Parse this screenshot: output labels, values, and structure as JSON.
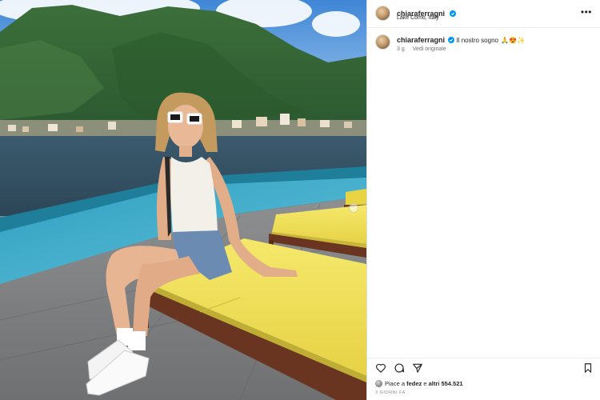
{
  "post": {
    "username": "chiaraferragni",
    "location": "Lake Como, Italy",
    "more_label": "•••",
    "caption": {
      "username": "chiaraferragni",
      "text": "Il nostro sogno",
      "emojis": "🙏😍✨",
      "age": "3 g",
      "translate_label": "Vedi originale"
    },
    "likes": {
      "prefix": "Piace a ",
      "first_user": "fedez",
      "connector": " e ",
      "others": "altri 554.521"
    },
    "date": "3 GIORNI FA"
  },
  "icons": {
    "verified": "verified-badge-icon",
    "like": "heart-icon",
    "comment": "comment-icon",
    "share": "paper-plane-icon",
    "save": "bookmark-icon",
    "more": "more-options-icon"
  },
  "colors": {
    "verified": "#0095f6",
    "text": "#262626",
    "muted": "#737373",
    "cushion": "#f2e35a",
    "pool": "#2f9fc0"
  }
}
